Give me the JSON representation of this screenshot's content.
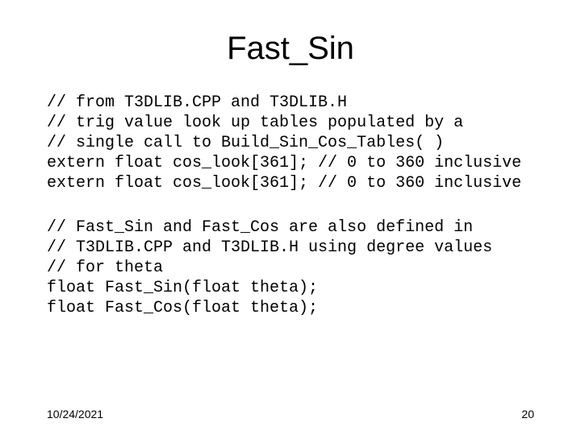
{
  "slide": {
    "title": "Fast_Sin",
    "code_block_1": "// from T3DLIB.CPP and T3DLIB.H\n// trig value look up tables populated by a\n// single call to Build_Sin_Cos_Tables( )\nextern float cos_look[361]; // 0 to 360 inclusive\nextern float cos_look[361]; // 0 to 360 inclusive",
    "code_block_2": "// Fast_Sin and Fast_Cos are also defined in\n// T3DLIB.CPP and T3DLIB.H using degree values\n// for theta\nfloat Fast_Sin(float theta);\nfloat Fast_Cos(float theta);",
    "footer": {
      "date": "10/24/2021",
      "page": "20"
    }
  }
}
